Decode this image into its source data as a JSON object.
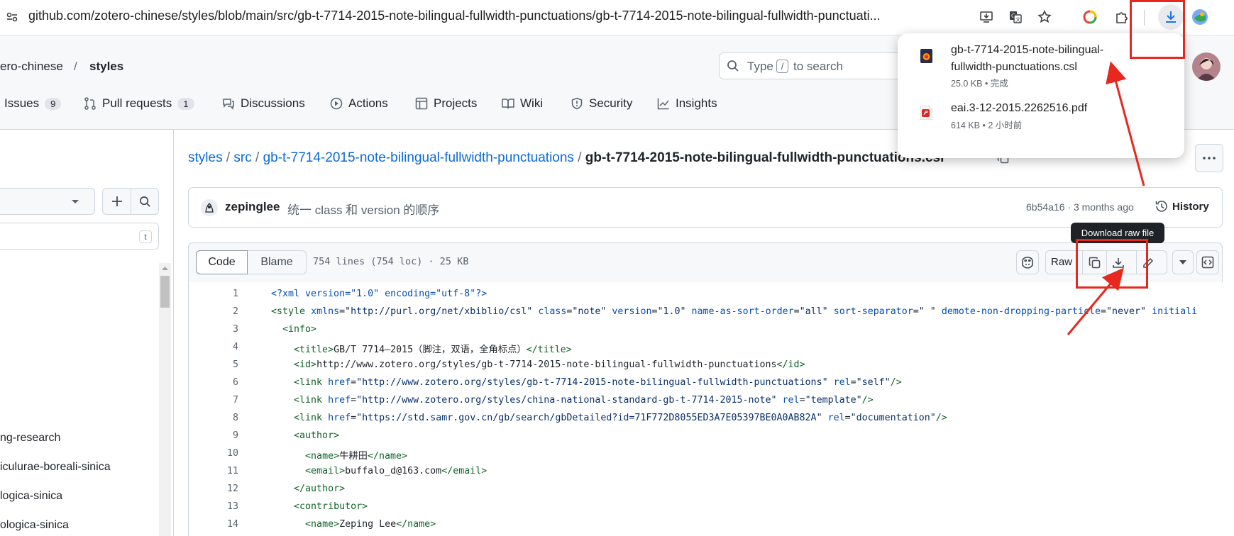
{
  "browser": {
    "url": "github.com/zotero-chinese/styles/blob/main/src/gb-t-7714-2015-note-bilingual-fullwidth-punctuations/gb-t-7714-2015-note-bilingual-fullwidth-punctuati..."
  },
  "repo": {
    "owner": "ero-chinese",
    "separator": "/",
    "name": "styles"
  },
  "search": {
    "prefix": "Type",
    "key": "/",
    "suffix": "to search"
  },
  "nav": [
    {
      "label": "Issues",
      "count": "9"
    },
    {
      "label": "Pull requests",
      "count": "1"
    },
    {
      "label": "Discussions"
    },
    {
      "label": "Actions"
    },
    {
      "label": "Projects"
    },
    {
      "label": "Wiki"
    },
    {
      "label": "Security"
    },
    {
      "label": "Insights"
    }
  ],
  "sidebar": {
    "filter_key": "t",
    "files": [
      "ng-research",
      "iculurae-boreali-sinica",
      "logica-sinica",
      "ologica-sinica"
    ]
  },
  "breadcrumb": {
    "root": "styles",
    "sep": "/",
    "src": "src",
    "folder": "gb-t-7714-2015-note-bilingual-fullwidth-punctuations",
    "file": "gb-t-7714-2015-note-bilingual-fullwidth-punctuations.csl"
  },
  "commit": {
    "author": "zepinglee",
    "message": "统一 class 和 version 的顺序",
    "hash_time": "6b54a16 · 3 months ago",
    "history": "History"
  },
  "file_header": {
    "code_tab": "Code",
    "blame_tab": "Blame",
    "info": "754 lines (754 loc) · 25 KB",
    "raw": "Raw",
    "tooltip": "Download raw file"
  },
  "downloads": [
    {
      "name_line1": "gb-t-7714-2015-note-bilingual-",
      "name_line2": "fullwidth-punctuations.csl",
      "meta": "25.0 KB • 完成"
    },
    {
      "name_line1": "eai.3-12-2015.2262516.pdf",
      "meta": "614 KB • 2 小时前"
    }
  ],
  "code_lines": [
    {
      "n": "1",
      "html": "<span class='pi'>&lt;?xml version=\"1.0\" encoding=\"utf-8\"?&gt;</span>"
    },
    {
      "n": "2",
      "html": "<span class='tag'>&lt;style</span> <span class='attr'>xmlns</span>=<span class='str'>\"http://purl.org/net/xbiblio/csl\"</span> <span class='attr'>class</span>=<span class='str'>\"note\"</span> <span class='attr'>version</span>=<span class='str'>\"1.0\"</span> <span class='attr'>name-as-sort-order</span>=<span class='str'>\"all\"</span> <span class='attr'>sort-separator</span>=<span class='str'>\" \"</span> <span class='attr'>demote-non-dropping-particle</span>=<span class='str'>\"never\"</span> <span class='attr'>initiali</span>"
    },
    {
      "n": "3",
      "html": "  <span class='tag'>&lt;info&gt;</span>"
    },
    {
      "n": "4",
      "html": "    <span class='tag'>&lt;title&gt;</span>GB/T 7714—2015（脚注，双语，全角标点）<span class='tag'>&lt;/title&gt;</span>"
    },
    {
      "n": "5",
      "html": "    <span class='tag'>&lt;id&gt;</span>http://www.zotero.org/styles/gb-t-7714-2015-note-bilingual-fullwidth-punctuations<span class='tag'>&lt;/id&gt;</span>"
    },
    {
      "n": "6",
      "html": "    <span class='tag'>&lt;link</span> <span class='attr'>href</span>=<span class='str'>\"http://www.zotero.org/styles/gb-t-7714-2015-note-bilingual-fullwidth-punctuations\"</span> <span class='attr'>rel</span>=<span class='str'>\"self\"</span><span class='tag'>/&gt;</span>"
    },
    {
      "n": "7",
      "html": "    <span class='tag'>&lt;link</span> <span class='attr'>href</span>=<span class='str'>\"http://www.zotero.org/styles/china-national-standard-gb-t-7714-2015-note\"</span> <span class='attr'>rel</span>=<span class='str'>\"template\"</span><span class='tag'>/&gt;</span>"
    },
    {
      "n": "8",
      "html": "    <span class='tag'>&lt;link</span> <span class='attr'>href</span>=<span class='str'>\"https://std.samr.gov.cn/gb/search/gbDetailed?id=71F772D8055ED3A7E05397BE0A0AB82A\"</span> <span class='attr'>rel</span>=<span class='str'>\"documentation\"</span><span class='tag'>/&gt;</span>"
    },
    {
      "n": "9",
      "html": "    <span class='tag'>&lt;author&gt;</span>"
    },
    {
      "n": "10",
      "html": "      <span class='tag'>&lt;name&gt;</span>牛耕田<span class='tag'>&lt;/name&gt;</span>"
    },
    {
      "n": "11",
      "html": "      <span class='tag'>&lt;email&gt;</span>buffalo_d@163.com<span class='tag'>&lt;/email&gt;</span>"
    },
    {
      "n": "12",
      "html": "    <span class='tag'>&lt;/author&gt;</span>"
    },
    {
      "n": "13",
      "html": "    <span class='tag'>&lt;contributor&gt;</span>"
    },
    {
      "n": "14",
      "html": "      <span class='tag'>&lt;name&gt;</span>Zeping Lee<span class='tag'>&lt;/name&gt;</span>"
    }
  ],
  "colors": {
    "annotation_red": "#e8281e",
    "link_blue": "#0969da"
  }
}
